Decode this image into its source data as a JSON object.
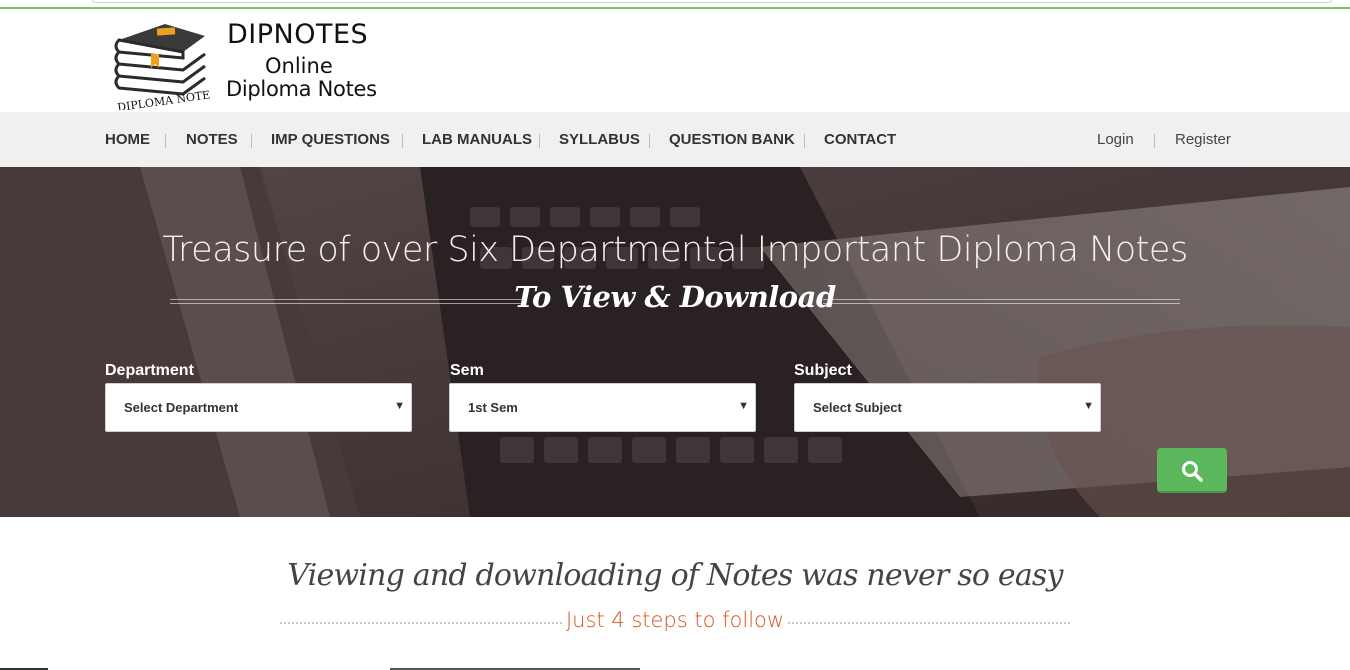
{
  "logo": {
    "title": "DIPNOTES",
    "line1": "Online",
    "line2": "Diploma Notes",
    "badge_text": "DIPLOMA NOTES",
    "icon": "books-stack-icon"
  },
  "nav": {
    "items": [
      {
        "label": "HOME"
      },
      {
        "label": "NOTES"
      },
      {
        "label": "IMP QUESTIONS"
      },
      {
        "label": "LAB MANUALS"
      },
      {
        "label": "SYLLABUS"
      },
      {
        "label": "QUESTION BANK"
      },
      {
        "label": "CONTACT"
      }
    ],
    "login": "Login",
    "register": "Register"
  },
  "hero": {
    "title": "Treasure of over Six Departmental Important Diploma Notes",
    "subtitle": "To View & Download",
    "fields": [
      {
        "label": "Department",
        "value": "Select Department"
      },
      {
        "label": "Sem",
        "value": "1st Sem"
      },
      {
        "label": "Subject",
        "value": "Select Subject"
      }
    ],
    "search_icon": "search-icon",
    "accent": "#5cb85c"
  },
  "intro": {
    "tagline": "Viewing and downloading of Notes was never so easy",
    "steps": "Just 4 steps to follow",
    "steps_color": "#d9531e"
  }
}
